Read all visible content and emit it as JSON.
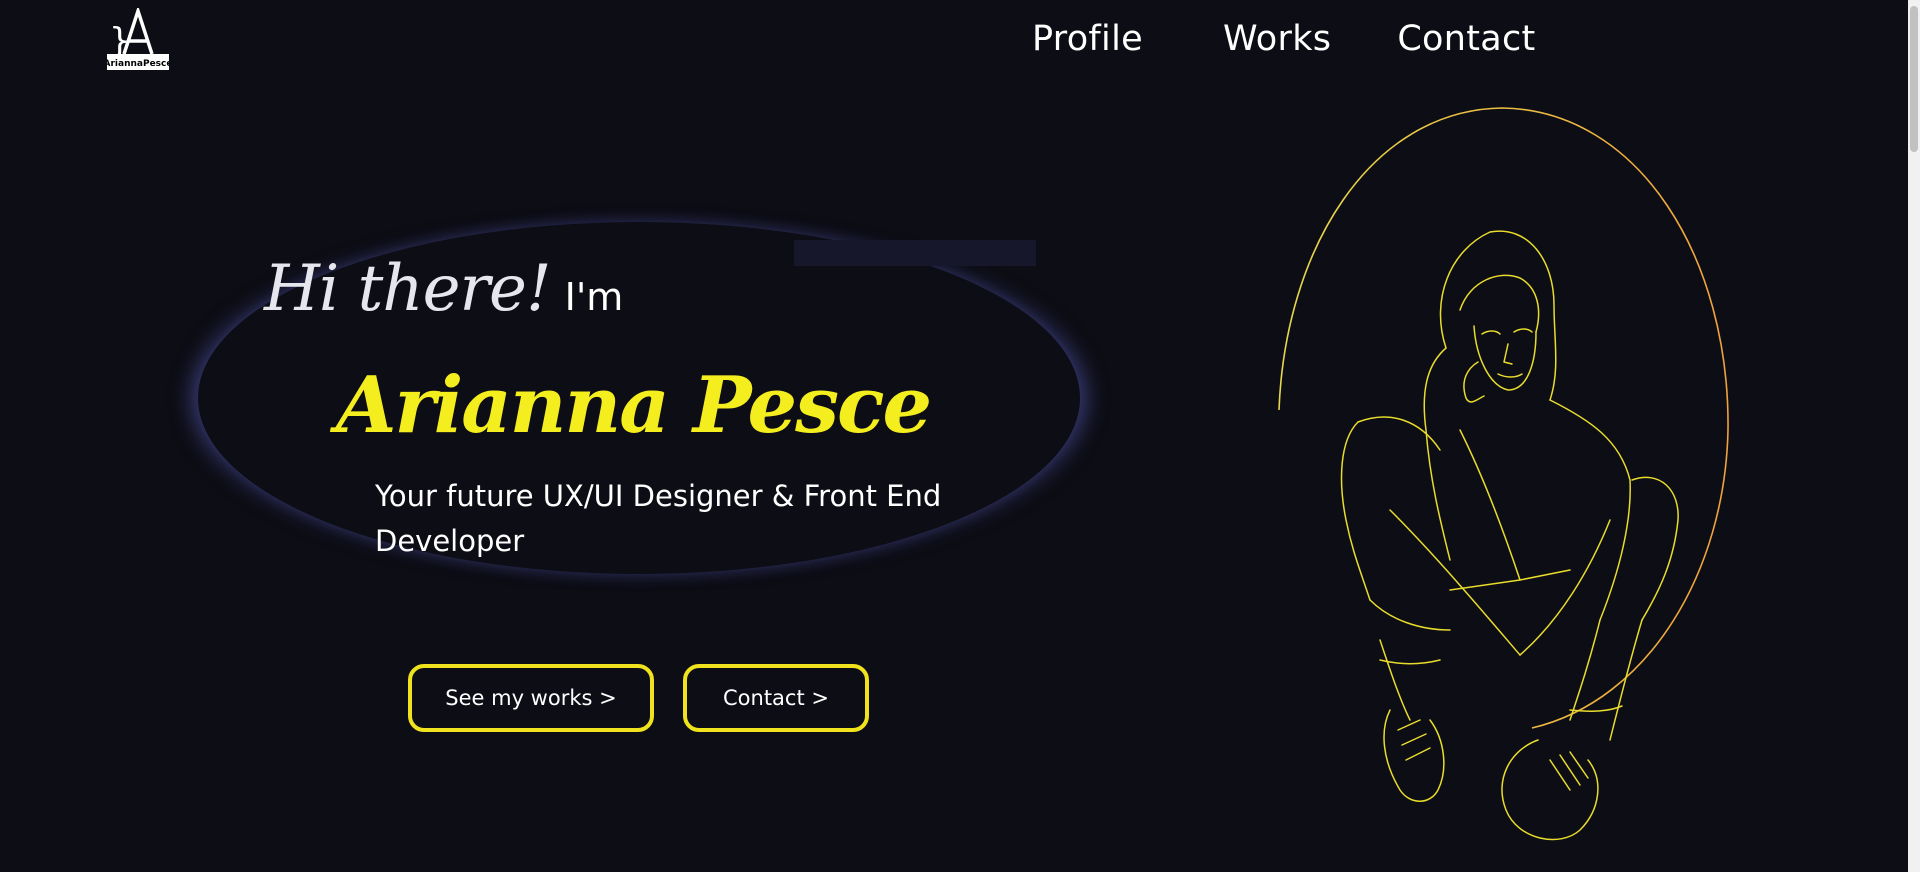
{
  "brand": {
    "logo_text": "AriannaPesce"
  },
  "nav": {
    "items": [
      "Profile",
      "Works",
      "Contact"
    ]
  },
  "hero": {
    "greeting": "Hi there!",
    "greeting_suffix": "I'm",
    "name": "Arianna Pesce",
    "tagline": "Your future UX/UI Designer & Front End Developer"
  },
  "buttons": {
    "works": "See my works >",
    "contact": "Contact >"
  },
  "colors": {
    "background": "#0d0d15",
    "accent": "#f5ee1e",
    "ring_gradient": [
      "#e6d84a",
      "#f0a23b"
    ]
  },
  "icons": {
    "logo": "brace-a-logo",
    "illustration": "line-art-woman-sitting"
  }
}
